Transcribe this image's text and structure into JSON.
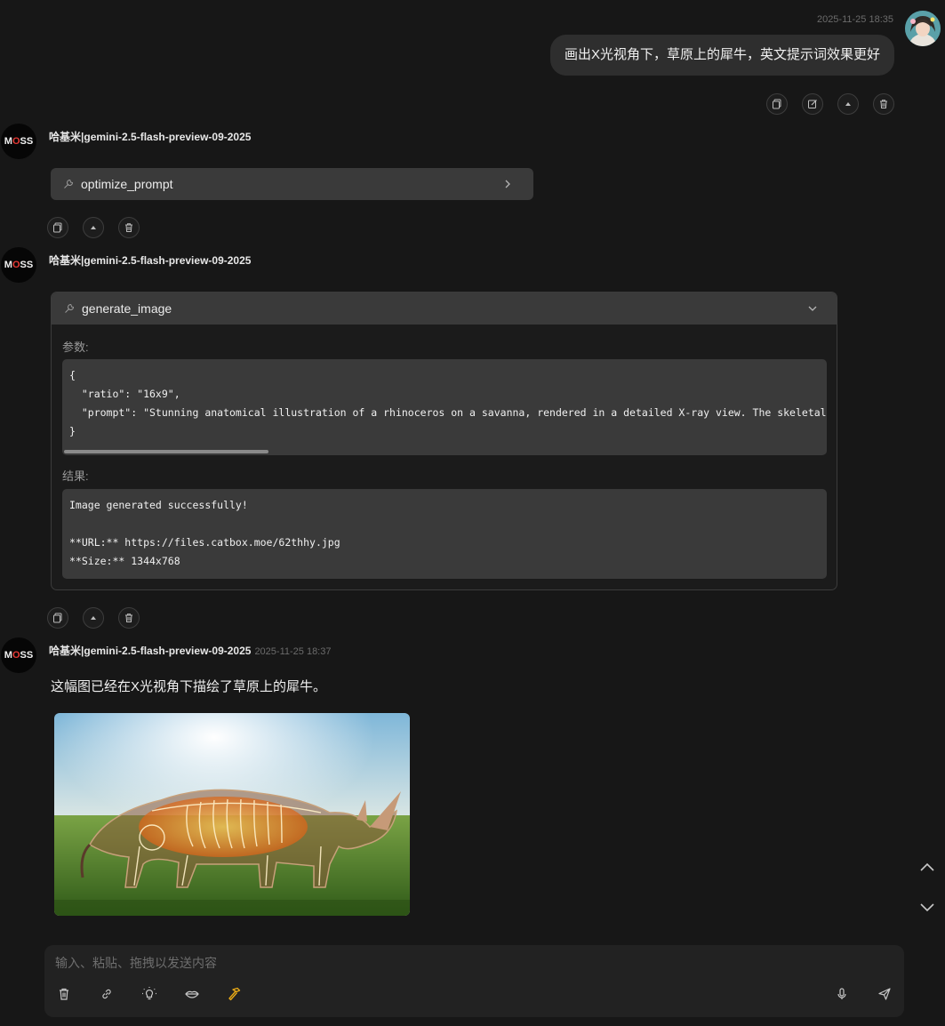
{
  "user_message": {
    "timestamp": "2025-11-25 18:35",
    "text": "画出X光视角下，草原上的犀牛，英文提示词效果更好"
  },
  "bot": {
    "name": "哈基米|gemini-2.5-flash-preview-09-2025",
    "avatar_text": "MOSS"
  },
  "tool_call_1": {
    "name": "optimize_prompt"
  },
  "tool_call_2": {
    "name": "generate_image",
    "params_label": "参数:",
    "params_lines": [
      "{",
      "  \"ratio\": \"16x9\",",
      "  \"prompt\": \"Stunning anatomical illustration of a rhinoceros on a savanna, rendered in a detailed X-ray view. The skeletal struc",
      "}"
    ],
    "result_label": "结果:",
    "result_lines": [
      "Image generated successfully!",
      "",
      "**URL:** https://files.catbox.moe/62thhy.jpg",
      "**Size:** 1344x768"
    ]
  },
  "final_message": {
    "timestamp": "2025-11-25 18:37",
    "text": "这幅图已经在X光视角下描绘了草原上的犀牛。"
  },
  "input": {
    "placeholder": "输入、粘贴、拖拽以发送内容"
  },
  "colors": {
    "background": "#171717",
    "bubble": "#2e2e2e",
    "panel": "#3a3a3a",
    "accent_hammer": "#e6a817",
    "avatar_o": "#e53935"
  }
}
